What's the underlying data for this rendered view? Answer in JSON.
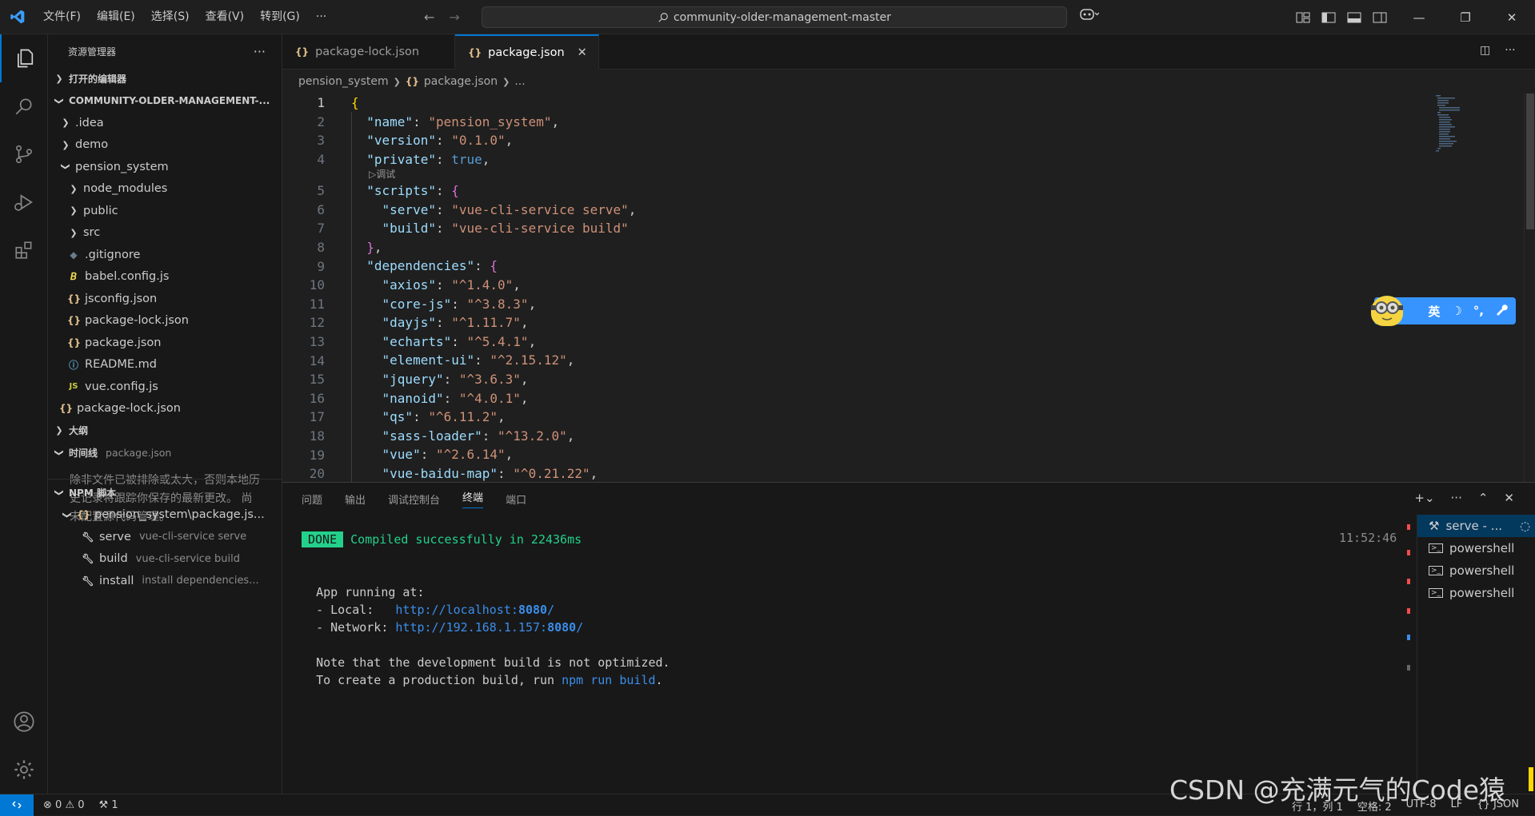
{
  "titlebar": {
    "menu": [
      "文件(F)",
      "编辑(E)",
      "选择(S)",
      "查看(V)",
      "转到(G)",
      "···"
    ],
    "search": "community-older-management-master"
  },
  "sidebar": {
    "title": "资源管理器",
    "open_editors": "打开的编辑器",
    "root": "COMMUNITY-OLDER-MANAGEMENT-...",
    "tree": [
      {
        "label": ".idea",
        "type": "folder",
        "depth": 1,
        "open": false
      },
      {
        "label": "demo",
        "type": "folder",
        "depth": 1,
        "open": false
      },
      {
        "label": "pension_system",
        "type": "folder",
        "depth": 1,
        "open": true
      },
      {
        "label": "node_modules",
        "type": "folder",
        "depth": 2,
        "open": false
      },
      {
        "label": "public",
        "type": "folder",
        "depth": 2,
        "open": false
      },
      {
        "label": "src",
        "type": "folder",
        "depth": 2,
        "open": false
      },
      {
        "label": ".gitignore",
        "type": "git",
        "depth": 2
      },
      {
        "label": "babel.config.js",
        "type": "babel",
        "depth": 2
      },
      {
        "label": "jsconfig.json",
        "type": "json",
        "depth": 2
      },
      {
        "label": "package-lock.json",
        "type": "json",
        "depth": 2
      },
      {
        "label": "package.json",
        "type": "json",
        "depth": 2
      },
      {
        "label": "README.md",
        "type": "info",
        "depth": 2
      },
      {
        "label": "vue.config.js",
        "type": "js",
        "depth": 2
      },
      {
        "label": "package-lock.json",
        "type": "json",
        "depth": 1
      }
    ],
    "outline": "大纲",
    "timeline": "时间线",
    "timeline_file": "package.json",
    "timeline_msg": "除非文件已被排除或太大，否则本地历史记录将跟踪你保存的最新更改。 尚未配置源代码管理。",
    "npm_title": "NPM 脚本",
    "npm_pkg": "pension_system\\package.js...",
    "npm_scripts": [
      {
        "name": "serve",
        "cmd": "vue-cli-service serve"
      },
      {
        "name": "build",
        "cmd": "vue-cli-service build"
      },
      {
        "name": "install",
        "cmd": "install dependencies..."
      }
    ]
  },
  "tabs": [
    {
      "label": "package-lock.json",
      "active": false
    },
    {
      "label": "package.json",
      "active": true
    }
  ],
  "breadcrumb": {
    "folder": "pension_system",
    "file": "package.json",
    "rest": "..."
  },
  "editor": {
    "codelens": "▷调试",
    "lines": [
      {
        "n": "1",
        "kind": "open"
      },
      {
        "n": "2",
        "key": "\"name\"",
        "val": "\"pension_system\"",
        "vt": "s",
        "indent": 1
      },
      {
        "n": "3",
        "key": "\"version\"",
        "val": "\"0.1.0\"",
        "vt": "s",
        "indent": 1
      },
      {
        "n": "4",
        "key": "\"private\"",
        "val": "true",
        "vt": "b",
        "indent": 1
      },
      {
        "n": "5",
        "key": "\"scripts\"",
        "val": "{",
        "vt": "br2",
        "indent": 1,
        "nocomma": true
      },
      {
        "n": "6",
        "key": "\"serve\"",
        "val": "\"vue-cli-service serve\"",
        "vt": "s",
        "indent": 2
      },
      {
        "n": "7",
        "key": "\"build\"",
        "val": "\"vue-cli-service build\"",
        "vt": "s",
        "indent": 2,
        "nocomma": true
      },
      {
        "n": "8",
        "kind": "close2"
      },
      {
        "n": "9",
        "key": "\"dependencies\"",
        "val": "{",
        "vt": "br2",
        "indent": 1,
        "nocomma": true
      },
      {
        "n": "10",
        "key": "\"axios\"",
        "val": "\"^1.4.0\"",
        "vt": "s",
        "indent": 2
      },
      {
        "n": "11",
        "key": "\"core-js\"",
        "val": "\"^3.8.3\"",
        "vt": "s",
        "indent": 2
      },
      {
        "n": "12",
        "key": "\"dayjs\"",
        "val": "\"^1.11.7\"",
        "vt": "s",
        "indent": 2
      },
      {
        "n": "13",
        "key": "\"echarts\"",
        "val": "\"^5.4.1\"",
        "vt": "s",
        "indent": 2
      },
      {
        "n": "14",
        "key": "\"element-ui\"",
        "val": "\"^2.15.12\"",
        "vt": "s",
        "indent": 2
      },
      {
        "n": "15",
        "key": "\"jquery\"",
        "val": "\"^3.6.3\"",
        "vt": "s",
        "indent": 2
      },
      {
        "n": "16",
        "key": "\"nanoid\"",
        "val": "\"^4.0.1\"",
        "vt": "s",
        "indent": 2
      },
      {
        "n": "17",
        "key": "\"qs\"",
        "val": "\"^6.11.2\"",
        "vt": "s",
        "indent": 2
      },
      {
        "n": "18",
        "key": "\"sass-loader\"",
        "val": "\"^13.2.0\"",
        "vt": "s",
        "indent": 2
      },
      {
        "n": "19",
        "key": "\"vue\"",
        "val": "\"^2.6.14\"",
        "vt": "s",
        "indent": 2
      },
      {
        "n": "20",
        "key": "\"vue-baidu-map\"",
        "val": "\"^0.21.22\"",
        "vt": "s",
        "indent": 2
      }
    ]
  },
  "ime": {
    "lang": "英",
    "moon": "☽",
    "dot": "°,",
    "tool": "🔧"
  },
  "panel": {
    "tabs": [
      "问题",
      "输出",
      "调试控制台",
      "终端",
      "端口"
    ],
    "active_tab": "终端",
    "time": "11:52:46",
    "done": "DONE",
    "compiled": "Compiled successfully in 22436ms",
    "app_running": "App running at:",
    "local_label": "- Local:   ",
    "local_url": "http://localhost:",
    "local_port": "8080",
    "network_label": "- Network: ",
    "network_url": "http://192.168.1.157:",
    "network_port": "8080",
    "note1": "Note that the development build is not optimized.",
    "note2_pre": "To create a production build, run ",
    "note2_cmd": "npm run build",
    "note2_post": ".",
    "terminals": [
      "serve - ...",
      "powershell",
      "powershell",
      "powershell"
    ]
  },
  "statusbar": {
    "errors": "0",
    "warnings": "0",
    "ports": "1",
    "position": "行 1，列 1",
    "spaces": "空格: 2",
    "encoding": "UTF-8",
    "eol": "LF",
    "lang": "{} JSON"
  },
  "watermark": "CSDN @充满元气的Code猿",
  "colors": {
    "accent": "#0078d4",
    "done_green": "#23d18b",
    "link_blue": "#3b8eea"
  }
}
